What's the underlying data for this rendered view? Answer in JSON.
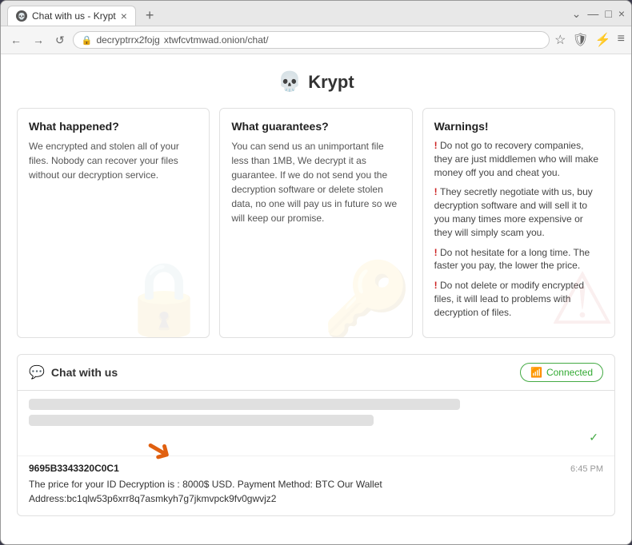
{
  "browser": {
    "tab_title": "Chat with us - Krypt",
    "tab_close": "×",
    "tab_new": "+",
    "url_protocol": "decryptrrx2fojg",
    "url_domain": "xtwfcvtmwad.onion/chat/",
    "nav_back": "←",
    "nav_forward": "→",
    "nav_refresh": "↺",
    "minimize": "—",
    "maximize": "□",
    "close": "×",
    "controls_down": "⌄",
    "controls_minimize": "—",
    "controls_maximize": "□",
    "controls_close": "×"
  },
  "page": {
    "title": "Krypt",
    "skull": "💀"
  },
  "cards": {
    "what_happened": {
      "title": "What happened?",
      "text": "We encrypted and stolen all of your files.\nNobody can recover your files without our decryption service.",
      "bg_icon": "🔒"
    },
    "what_guarantees": {
      "title": "What guarantees?",
      "text": "You can send us an unimportant file less than 1MB, We decrypt it as guarantee.\n\nIf we do not send you the decryption software or delete stolen data, no one will pay us in future so we will keep our promise.",
      "bg_icon": "🔑"
    },
    "warnings": {
      "title": "Warnings!",
      "items": [
        "Do not go to recovery companies, they are just middlemen who will make money off you and cheat you.",
        "They secretly negotiate with us, buy decryption software and will sell it to you many times more expensive or they will simply scam you.",
        "Do not hesitate for a long time. The faster you pay, the lower the price.",
        "Do not delete or modify encrypted files, it will lead to problems with decryption of files."
      ],
      "bg_icon": "⚠"
    }
  },
  "chat": {
    "title": "Chat with us",
    "icon": "💬",
    "connected_label": "Connected",
    "sender_id": "9695B3343320C0C1",
    "message_time": "6:45 PM",
    "message_body": "The price for your ID Decryption is : 8000$ USD. Payment Method: BTC Our Wallet Address:bc1qlw53p6xrr8q7asmkyh7g7jkmvpck9fv0gwvjz2"
  }
}
